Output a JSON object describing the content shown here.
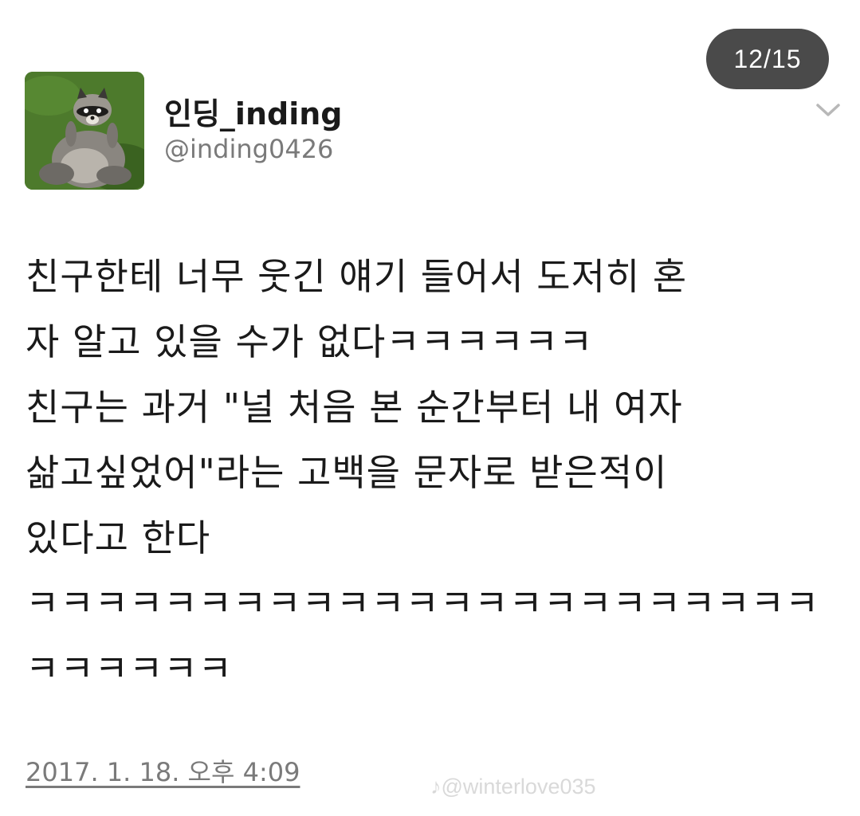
{
  "page_counter": "12/15",
  "author": {
    "display_name": "인딩_inding",
    "handle": "@inding0426",
    "avatar_icon": "raccoon-avatar"
  },
  "menu_icon": "chevron-down-icon",
  "tweet": {
    "lines": [
      "친구한테 너무 웃긴 얘기 들어서 도저히 혼",
      "자 알고 있을 수가 없다ㅋㅋㅋㅋㅋㅋ",
      "친구는 과거 \"널 처음 본 순간부터 내 여자",
      "삶고싶었어\"라는 고백을 문자로 받은적이",
      "있다고 한다",
      "ㅋㅋㅋㅋㅋㅋㅋㅋㅋㅋㅋㅋㅋㅋㅋㅋㅋㅋㅋㅋㅋㅋㅋ",
      "ㅋㅋㅋㅋㅋㅋ"
    ],
    "timestamp": "2017. 1. 18. 오후 4:09"
  },
  "watermark": "♪@winterlove035"
}
